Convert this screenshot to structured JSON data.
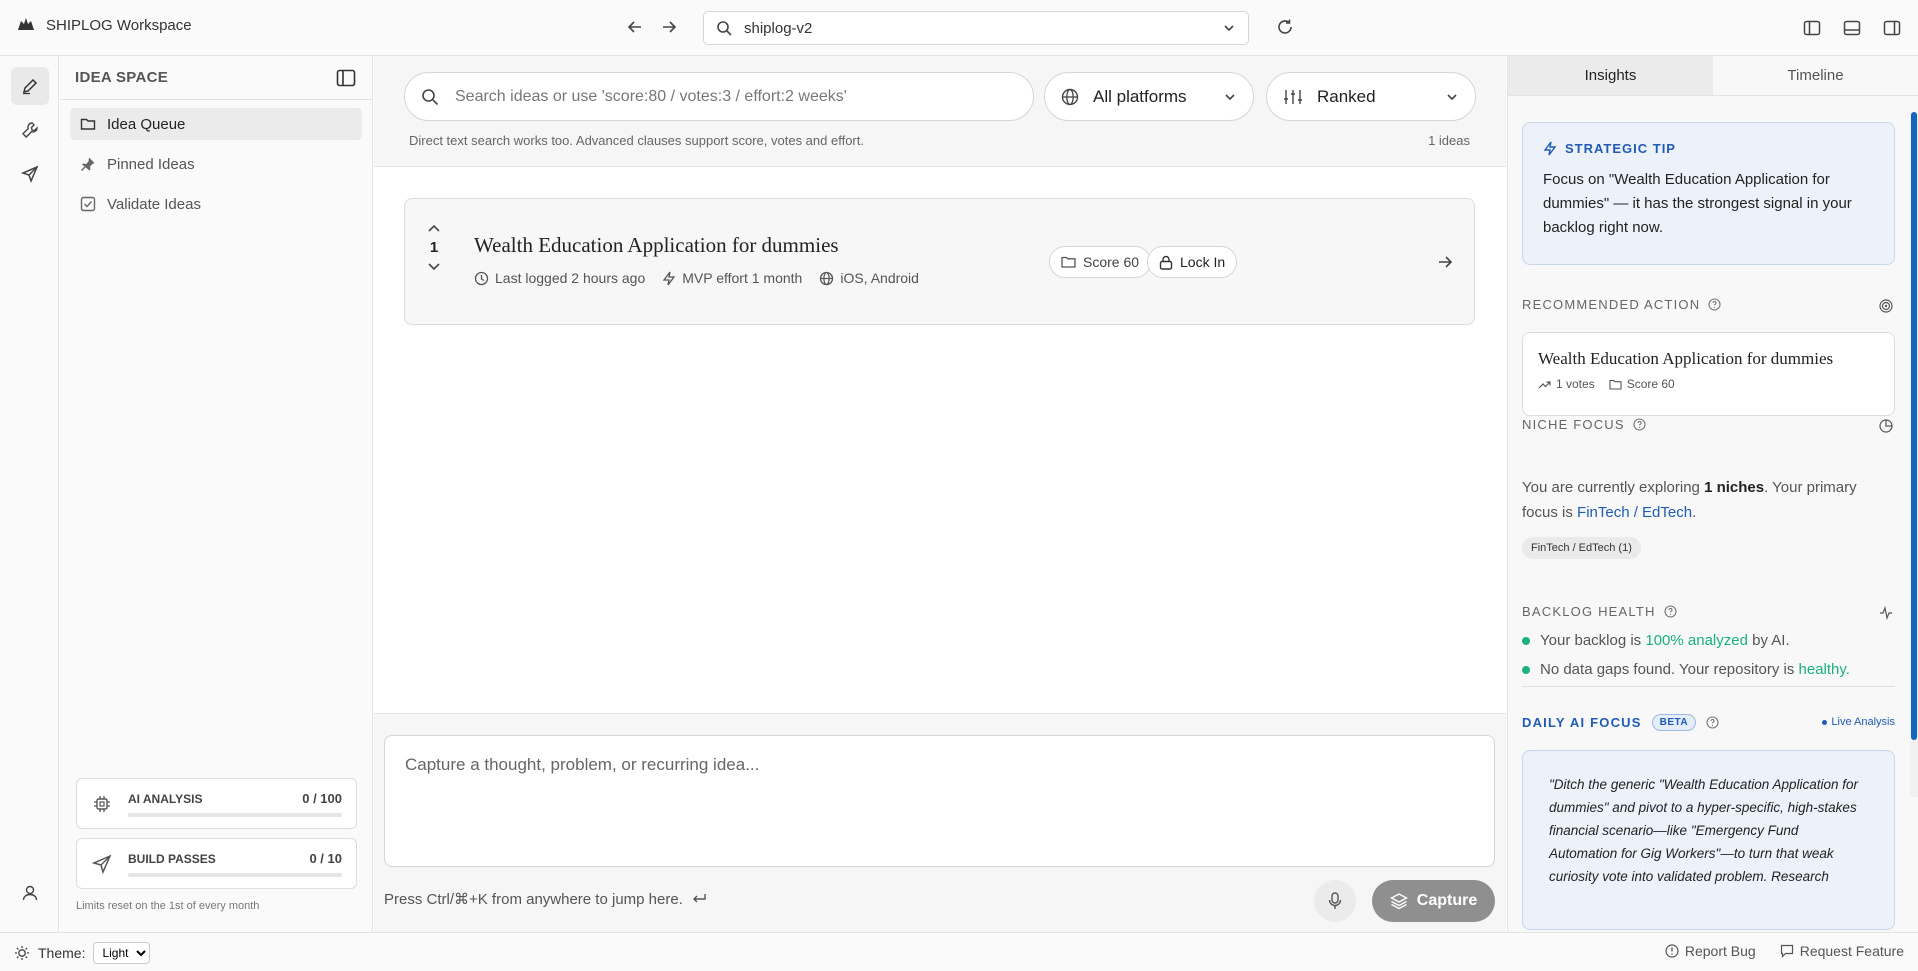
{
  "topbar": {
    "app_title": "SHIPLOG Workspace",
    "address": "shiplog-v2",
    "icons": [
      "app-logo-icon",
      "back-arrow-icon",
      "forward-arrow-icon",
      "search-icon",
      "chevron-down-icon",
      "refresh-icon",
      "left-panel-icon",
      "bottom-panel-icon",
      "right-panel-icon"
    ]
  },
  "rail": {
    "icons": [
      "pencil-icon",
      "wrench-icon",
      "send-icon",
      "user-icon"
    ]
  },
  "sidebar": {
    "title": "IDEA SPACE",
    "items": [
      {
        "label": "Idea Queue",
        "icon": "folder-icon",
        "active": true
      },
      {
        "label": "Pinned Ideas",
        "icon": "pin-icon",
        "active": false
      },
      {
        "label": "Validate Ideas",
        "icon": "checkbox-icon",
        "active": false
      }
    ],
    "usage": [
      {
        "label": "AI ANALYSIS",
        "value": "0 / 100",
        "fraction": 0
      },
      {
        "label": "BUILD PASSES",
        "value": "0 / 10",
        "fraction": 0
      }
    ],
    "limits_note": "Limits reset on the 1st of every month"
  },
  "main": {
    "search_placeholder": "Search ideas or use 'score:80 / votes:3 / effort:2 weeks'",
    "platform_filter": "All platforms",
    "sort": "Ranked",
    "hint": "Direct text search works too. Advanced clauses support score, votes and effort.",
    "count": "1 ideas",
    "ideas": [
      {
        "votes": "1",
        "title": "Wealth Education Application for dummies",
        "logged": "Last logged 2 hours ago",
        "effort": "MVP effort 1 month",
        "platforms": "iOS, Android",
        "score": "Score 60",
        "lock": "Lock In"
      }
    ],
    "composer_placeholder": "Capture a thought, problem, or recurring idea...",
    "shortcut_hint": "Press Ctrl/⌘+K from anywhere to jump here.",
    "capture_label": "Capture"
  },
  "insights": {
    "tabs": [
      "Insights",
      "Timeline"
    ],
    "tip": {
      "heading": "STRATEGIC TIP",
      "text": "Focus on \"Wealth Education Application for dummies\" — it has the strongest signal in your backlog right now."
    },
    "recommended": {
      "label": "RECOMMENDED ACTION",
      "title": "Wealth Education Application for dummies",
      "votes": "1 votes",
      "score": "Score 60"
    },
    "niche": {
      "label": "NICHE FOCUS",
      "text_1": "You are currently exploring ",
      "count": "1 niches",
      "text_2": ". Your primary focus is ",
      "focus": "FinTech / EdTech",
      "text_3": ".",
      "tag": "FinTech / EdTech (1)"
    },
    "health": {
      "label": "BACKLOG HEALTH",
      "line1_a": "Your backlog is ",
      "line1_b": "100% analyzed",
      "line1_c": " by AI.",
      "line2_a": "No data gaps found. Your repository is ",
      "line2_b": "healthy."
    },
    "daily": {
      "label": "DAILY AI FOCUS",
      "badge": "BETA",
      "live": "Live Analysis",
      "quote": "\"Ditch the generic \"Wealth Education Application for dummies\" and pivot to a hyper-specific, high-stakes financial scenario—like \"Emergency Fund Automation for Gig Workers\"—to turn that weak curiosity vote into validated problem. Research"
    }
  },
  "footer": {
    "theme_label": "Theme:",
    "theme_value": "Light",
    "report_bug": "Report Bug",
    "request_feature": "Request Feature"
  },
  "colors": {
    "accent_blue": "#1f5bb5",
    "healthy_green": "#1bb27b",
    "capture_button": "#8f8f8f"
  }
}
